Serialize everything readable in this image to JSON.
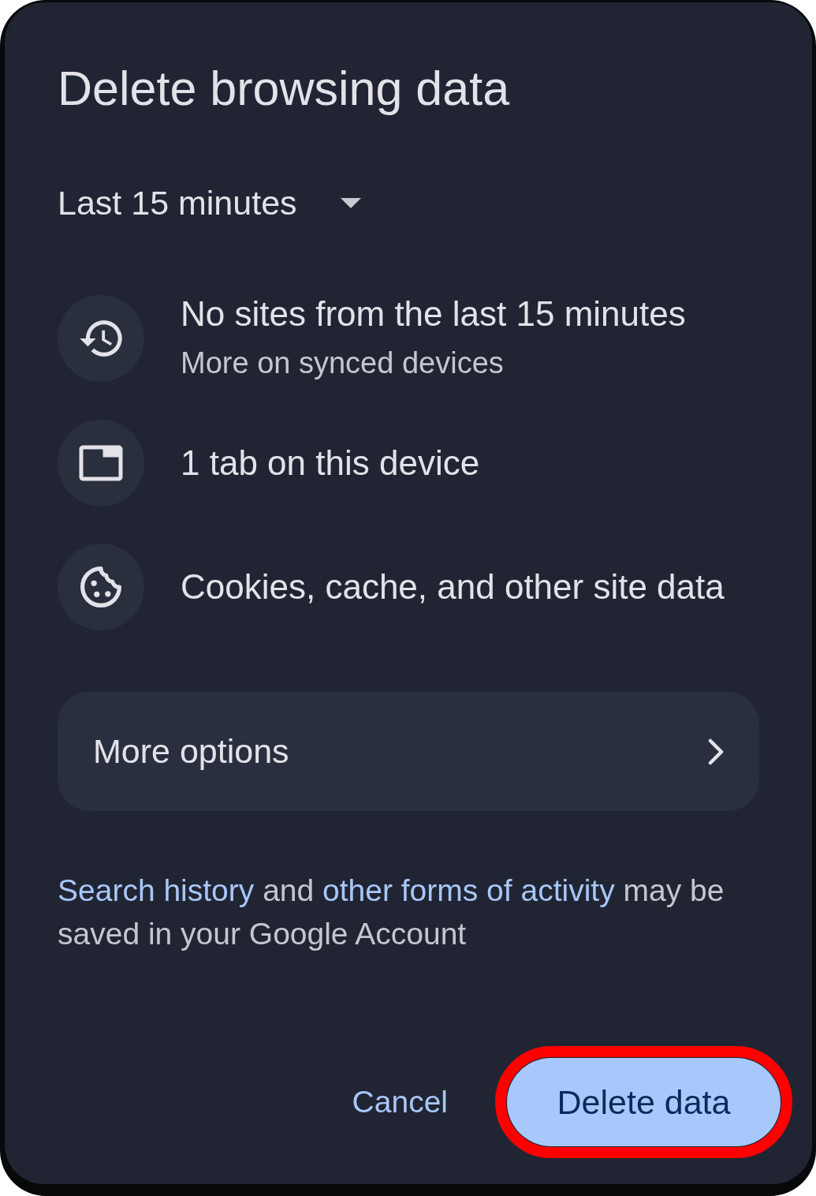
{
  "dialog": {
    "title": "Delete browsing data"
  },
  "time_range": {
    "value": "Last 15 minutes"
  },
  "items": [
    {
      "kind": "history",
      "title": "No sites from the last 15 minutes",
      "subtitle": "More on synced devices"
    },
    {
      "kind": "tab",
      "title": "1 tab on this device"
    },
    {
      "kind": "cookie",
      "title": "Cookies, cache, and other site data"
    }
  ],
  "more_options": {
    "label": "More options"
  },
  "notice": [
    {
      "text": "Search history",
      "link": true
    },
    {
      "text": "and",
      "link": false
    },
    {
      "text": "other forms of activity",
      "link": true
    },
    {
      "text": "may be saved in your Google Account",
      "link": false
    }
  ],
  "actions": [
    {
      "kind": "text",
      "label": "Cancel",
      "highlighted": false
    },
    {
      "kind": "filled",
      "label": "Delete data",
      "highlighted": true
    }
  ]
}
